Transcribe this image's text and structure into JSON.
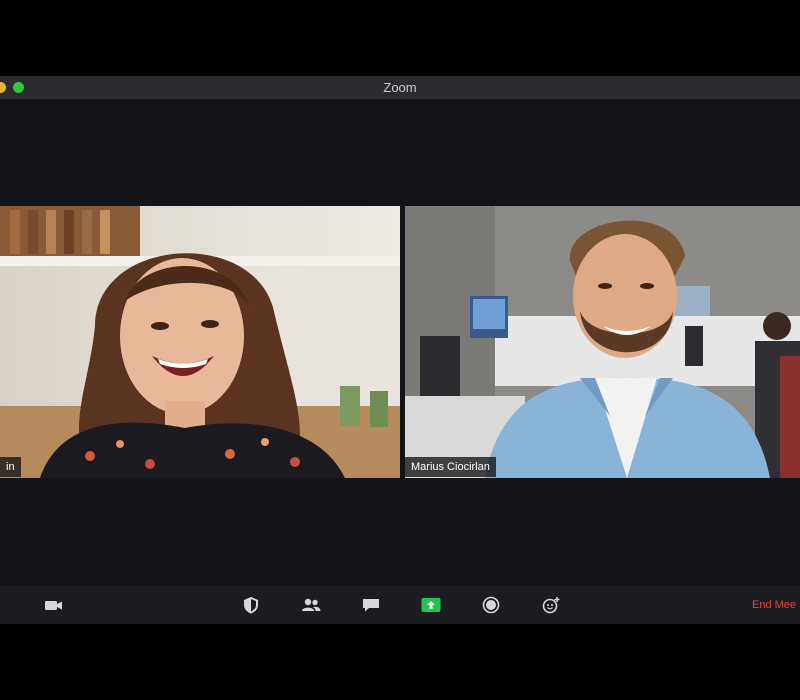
{
  "window": {
    "title": "Zoom"
  },
  "participants": [
    {
      "name": "in",
      "active_speaker": true
    },
    {
      "name": "Marius Ciocirlan",
      "active_speaker": false
    }
  ],
  "toolbar": {
    "icons": [
      "video-camera-icon",
      "shield-security-icon",
      "participants-icon",
      "chat-icon",
      "share-screen-icon",
      "record-icon",
      "reactions-icon"
    ],
    "end_label": "End Mee",
    "share_color": "#23c552",
    "end_color": "#e0453d"
  },
  "colors": {
    "active_border": "#b7d96a",
    "background": "#121417"
  }
}
